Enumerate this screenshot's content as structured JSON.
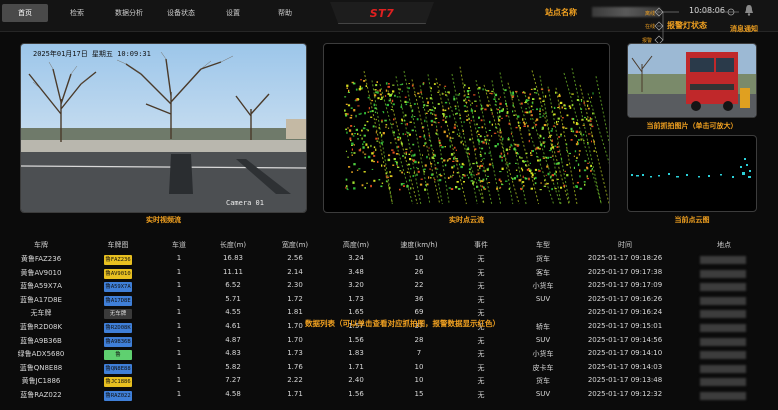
{
  "nav": {
    "tabs": [
      {
        "label": "首页",
        "active": true
      },
      {
        "label": "检索"
      },
      {
        "label": "数据分析"
      },
      {
        "label": "设备状态"
      },
      {
        "label": "设置"
      },
      {
        "label": "帮助"
      }
    ]
  },
  "header": {
    "brand": "ST7",
    "site_label": "站点名称",
    "time": "10:08:06",
    "alarm_label": "报警灯状态",
    "alarm_small_labels": [
      "离线",
      "在线",
      "报警"
    ],
    "message_label": "消息通知"
  },
  "panels": {
    "video_caption": "实时视频流",
    "video_overlay_text": "2025年01月17日 星期五 10:09:31",
    "video_overlay_bottom": "Camera 01",
    "pointcloud_caption": "实时点云流",
    "snapshot_caption": "当前抓拍图片（单击可放大）",
    "current_cloud_caption": "当前点云图"
  },
  "table": {
    "headers": [
      "车牌",
      "车牌图",
      "车道",
      "长度(m)",
      "宽度(m)",
      "高度(m)",
      "速度(km/h)",
      "事件",
      "车型",
      "时间",
      "地点"
    ],
    "rows": [
      {
        "plate": "黄鲁FAZ236",
        "plate_img": "鲁FAZ236",
        "plate_color": "#e8c020",
        "lane": "1",
        "length": "16.83",
        "width": "2.56",
        "height": "3.24",
        "speed": "10",
        "event": "无",
        "type": "货车",
        "time": "2025-01-17 09:18:26"
      },
      {
        "plate": "黄鲁AV9010",
        "plate_img": "鲁AV9010",
        "plate_color": "#e8c020",
        "lane": "1",
        "length": "11.11",
        "width": "2.14",
        "height": "3.48",
        "speed": "26",
        "event": "无",
        "type": "客车",
        "time": "2025-01-17 09:17:38"
      },
      {
        "plate": "蓝鲁A59X7A",
        "plate_img": "鲁A59X7A",
        "plate_color": "#3f7fd8",
        "lane": "1",
        "length": "6.52",
        "width": "2.30",
        "height": "3.20",
        "speed": "22",
        "event": "无",
        "type": "小货车",
        "time": "2025-01-17 09:17:09"
      },
      {
        "plate": "蓝鲁A17D8E",
        "plate_img": "鲁A17D8E",
        "plate_color": "#3f7fd8",
        "lane": "1",
        "length": "5.71",
        "width": "1.72",
        "height": "1.73",
        "speed": "36",
        "event": "无",
        "type": "SUV",
        "time": "2025-01-17 09:16:26"
      },
      {
        "plate": "无车牌",
        "plate_img": "无车牌",
        "plate_color": "none",
        "lane": "1",
        "length": "4.55",
        "width": "1.81",
        "height": "1.65",
        "speed": "69",
        "event": "无",
        "type": "",
        "time": "2025-01-17 09:16:24"
      },
      {
        "plate": "蓝鲁R2D08K",
        "plate_img": "鲁R2D08K",
        "plate_color": "#3f7fd8",
        "lane": "1",
        "length": "4.61",
        "width": "1.70",
        "height": "1.57",
        "speed": "37",
        "event": "无",
        "type": "轿车",
        "time": "2025-01-17 09:15:01"
      },
      {
        "plate": "蓝鲁A9B36B",
        "plate_img": "鲁A9B36B",
        "plate_color": "#3f7fd8",
        "lane": "1",
        "length": "4.87",
        "width": "1.70",
        "height": "1.56",
        "speed": "28",
        "event": "无",
        "type": "SUV",
        "time": "2025-01-17 09:14:56"
      },
      {
        "plate": "绿鲁ADX5680",
        "plate_img": "鲁ADX5680",
        "plate_color": "#5fd070",
        "lane": "1",
        "length": "4.83",
        "width": "1.73",
        "height": "1.83",
        "speed": "7",
        "event": "无",
        "type": "小货车",
        "time": "2025-01-17 09:14:10"
      },
      {
        "plate": "蓝鲁QN8E88",
        "plate_img": "鲁QN8E88",
        "plate_color": "#3f7fd8",
        "lane": "1",
        "length": "5.82",
        "width": "1.76",
        "height": "1.71",
        "speed": "10",
        "event": "无",
        "type": "皮卡车",
        "time": "2025-01-17 09:14:03"
      },
      {
        "plate": "黄鲁JC1886",
        "plate_img": "鲁JC1886",
        "plate_color": "#e8c020",
        "lane": "1",
        "length": "7.27",
        "width": "2.22",
        "height": "2.40",
        "speed": "10",
        "event": "无",
        "type": "货车",
        "time": "2025-01-17 09:13:48"
      },
      {
        "plate": "蓝鲁RAZ022",
        "plate_img": "鲁RAZ022",
        "plate_color": "#3f7fd8",
        "lane": "1",
        "length": "4.58",
        "width": "1.71",
        "height": "1.56",
        "speed": "15",
        "event": "无",
        "type": "SUV",
        "time": "2025-01-17 09:12:32"
      }
    ],
    "note": "数据列表（可以单击查看对应抓拍图，报警数据显示红色）"
  }
}
